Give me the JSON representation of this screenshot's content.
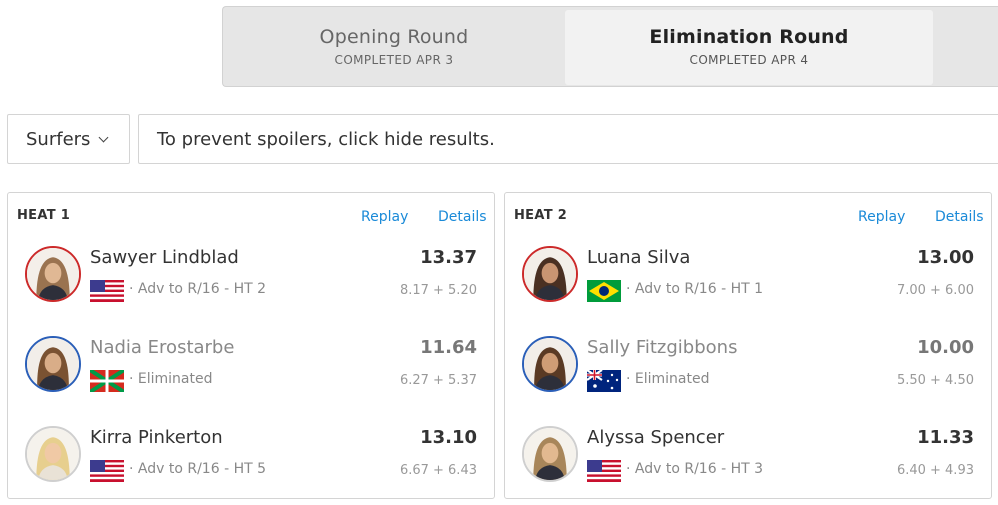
{
  "rounds": [
    {
      "name": "Opening Round",
      "status": "COMPLETED APR 3"
    },
    {
      "name": "Elimination Round",
      "status": "COMPLETED APR 4"
    }
  ],
  "filter": {
    "label": "Surfers"
  },
  "spoiler_text": "To prevent spoilers, click hide results.",
  "links": {
    "replay": "Replay",
    "details": "Details"
  },
  "heats": [
    {
      "title": "HEAT 1",
      "surfers": [
        {
          "name": "Sawyer Lindblad",
          "flag": "usa-flag-icon",
          "status": "· Adv to R/16 - HT 2",
          "total": "13.37",
          "waves": "8.17 + 5.20"
        },
        {
          "name": "Nadia Erostarbe",
          "flag": "basque-flag-icon",
          "status": "· Eliminated",
          "total": "11.64",
          "waves": "6.27 + 5.37"
        },
        {
          "name": "Kirra Pinkerton",
          "flag": "usa-flag-icon",
          "status": "· Adv to R/16 - HT 5",
          "total": "13.10",
          "waves": "6.67 + 6.43"
        }
      ]
    },
    {
      "title": "HEAT 2",
      "surfers": [
        {
          "name": "Luana Silva",
          "flag": "brazil-flag-icon",
          "status": "· Adv to R/16 - HT 1",
          "total": "13.00",
          "waves": "7.00 + 6.00"
        },
        {
          "name": "Sally Fitzgibbons",
          "flag": "australia-flag-icon",
          "status": "· Eliminated",
          "total": "10.00",
          "waves": "5.50 + 4.50"
        },
        {
          "name": "Alyssa Spencer",
          "flag": "usa-flag-icon",
          "status": "· Adv to R/16 - HT 3",
          "total": "11.33",
          "waves": "6.40 + 4.93"
        }
      ]
    }
  ],
  "colors": {
    "link": "#1a8ad8",
    "advanced_ring": "#cc2a2a",
    "eliminated_ring": "#2b5fb8"
  }
}
